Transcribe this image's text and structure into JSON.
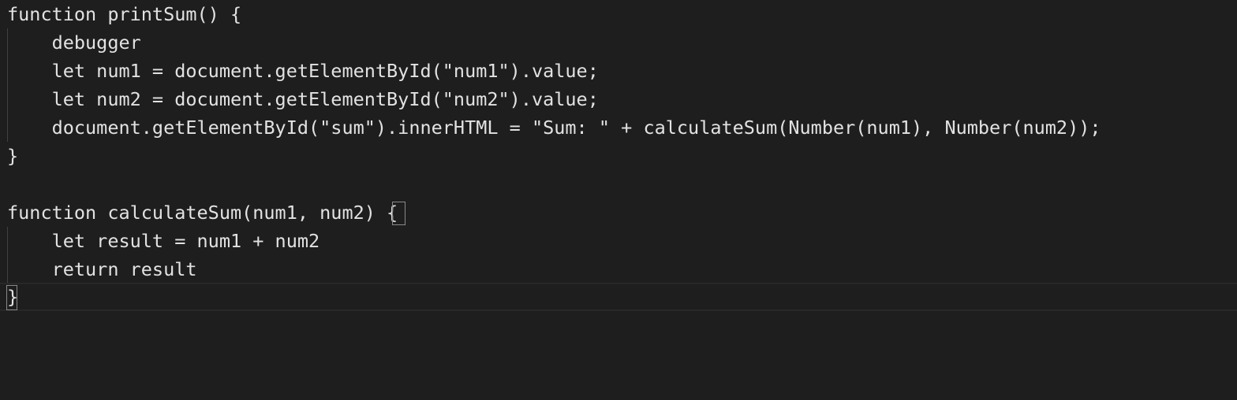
{
  "editor": {
    "lines": [
      "function printSum() {",
      "    debugger",
      "    let num1 = document.getElementById(\"num1\").value;",
      "    let num2 = document.getElementById(\"num2\").value;",
      "    document.getElementById(\"sum\").innerHTML = \"Sum: \" + calculateSum(Number(num1), Number(num2));",
      "}",
      "",
      "function calculateSum(num1, num2) {",
      "    let result = num1 + num2",
      "    return result",
      "}"
    ],
    "current_line": 11
  },
  "colors": {
    "background": "#1e1e1e",
    "text": "#e2e2e2",
    "indent_guide": "#404040",
    "current_line_border": "#282828",
    "bracket_match_border": "#8a8a8a"
  }
}
